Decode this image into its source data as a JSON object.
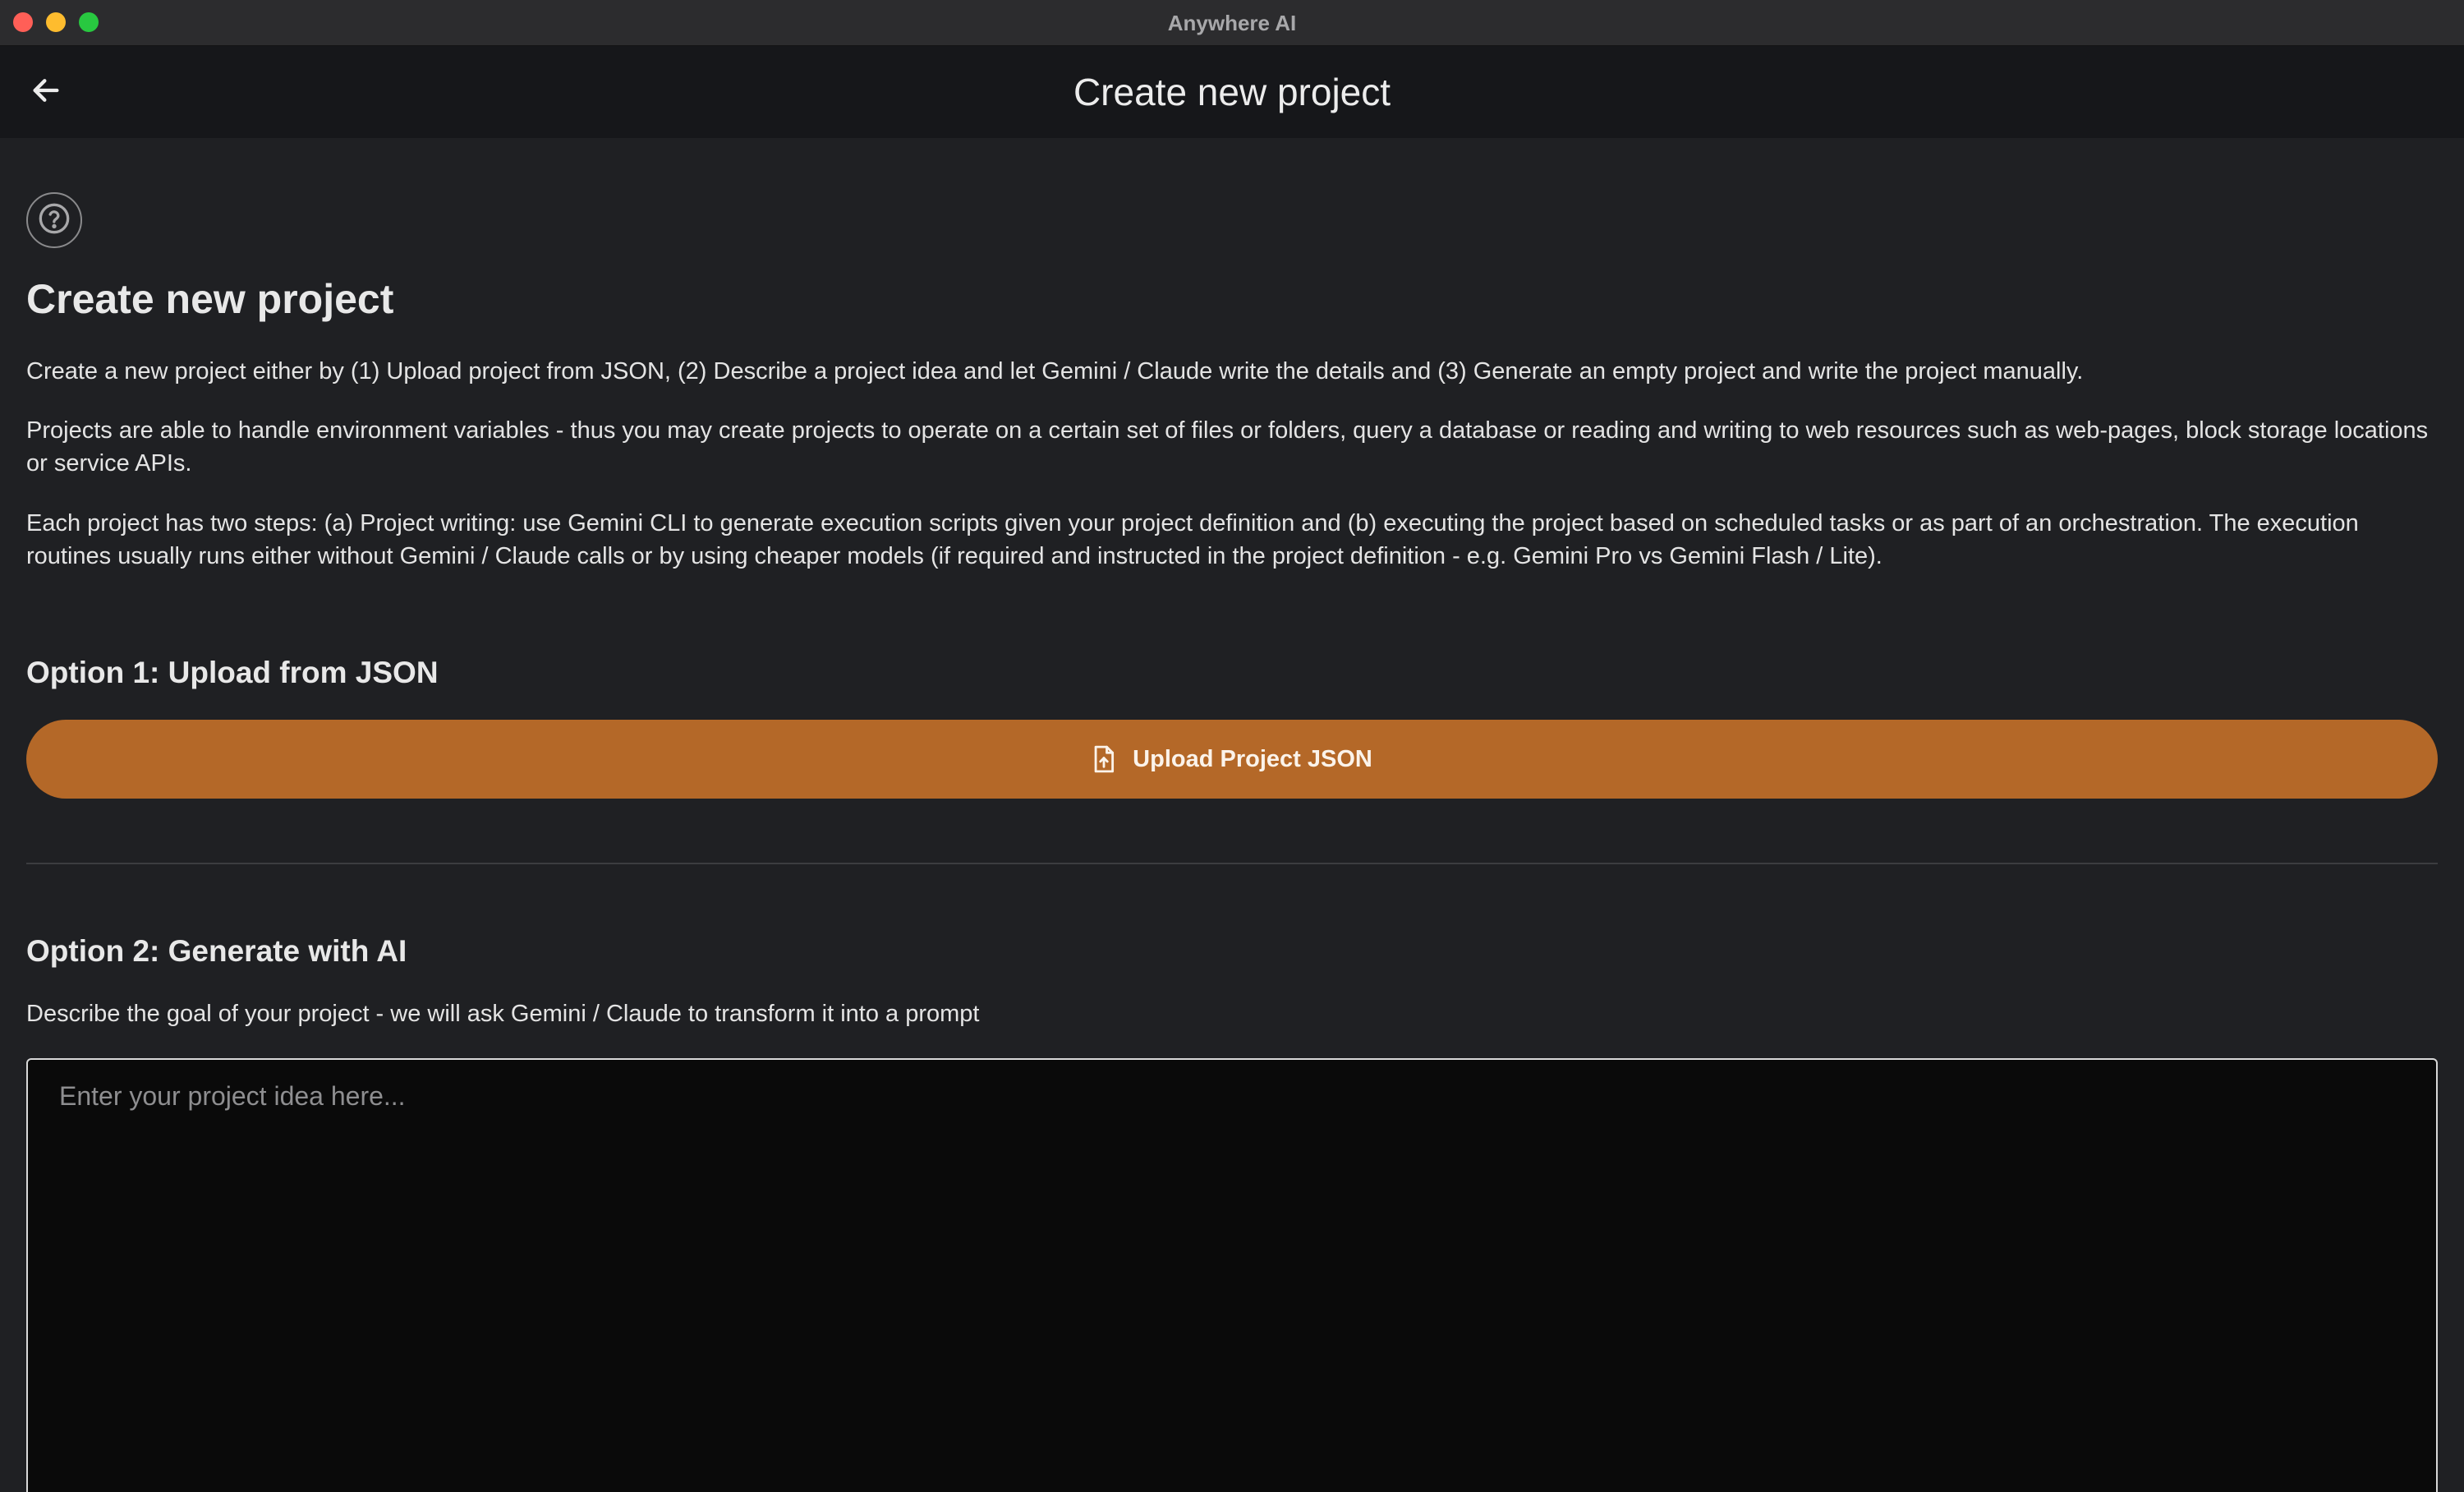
{
  "window": {
    "title": "Anywhere AI"
  },
  "appbar": {
    "back_icon": "arrow-left-icon",
    "title": "Create new project"
  },
  "help": {
    "icon": "help-circle-icon"
  },
  "intro": {
    "heading": "Create new project",
    "paragraph_1": "Create a new project either by (1) Upload project from JSON, (2) Describe a project idea and let Gemini / Claude write the details and (3) Generate an empty project and write the project manually.",
    "paragraph_2": "Projects are able to handle environment variables - thus you may create projects to operate on a certain set of files or folders, query a database or reading and writing to web resources such as web-pages, block storage locations or service APIs.",
    "paragraph_3": "Each project has two steps: (a) Project writing: use Gemini CLI to generate execution scripts given your project definition and (b) executing the project based on scheduled tasks or as part of an orchestration. The execution routines usually runs either without Gemini / Claude calls or by using cheaper models (if required and instructed in the project definition - e.g. Gemini Pro vs Gemini Flash / Lite)."
  },
  "option1": {
    "heading": "Option 1: Upload from JSON",
    "button_label": "Upload Project JSON",
    "button_icon": "file-upload-icon",
    "button_color": "#b46828"
  },
  "option2": {
    "heading": "Option 2: Generate with AI",
    "description": "Describe the goal of your project - we will ask Gemini / Claude to transform it into a prompt",
    "input_value": "",
    "input_placeholder": "Enter your project idea here..."
  }
}
